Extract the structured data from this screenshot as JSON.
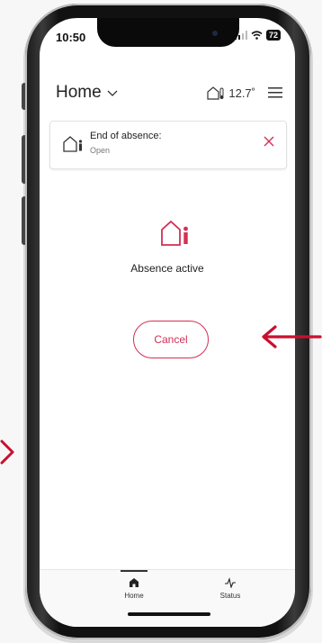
{
  "status_bar": {
    "time": "10:50",
    "battery": "72"
  },
  "header": {
    "title": "Home",
    "temperature": "12.7˚"
  },
  "absence_card": {
    "title": "End of absence:",
    "subtitle": "Open"
  },
  "main": {
    "status_label": "Absence active",
    "cancel_label": "Cancel"
  },
  "tabs": [
    {
      "label": "Home",
      "icon": "house-icon",
      "active": true
    },
    {
      "label": "Status",
      "icon": "pulse-icon",
      "active": false
    }
  ],
  "colors": {
    "accent": "#d32f55",
    "arrow": "#c8102e"
  }
}
